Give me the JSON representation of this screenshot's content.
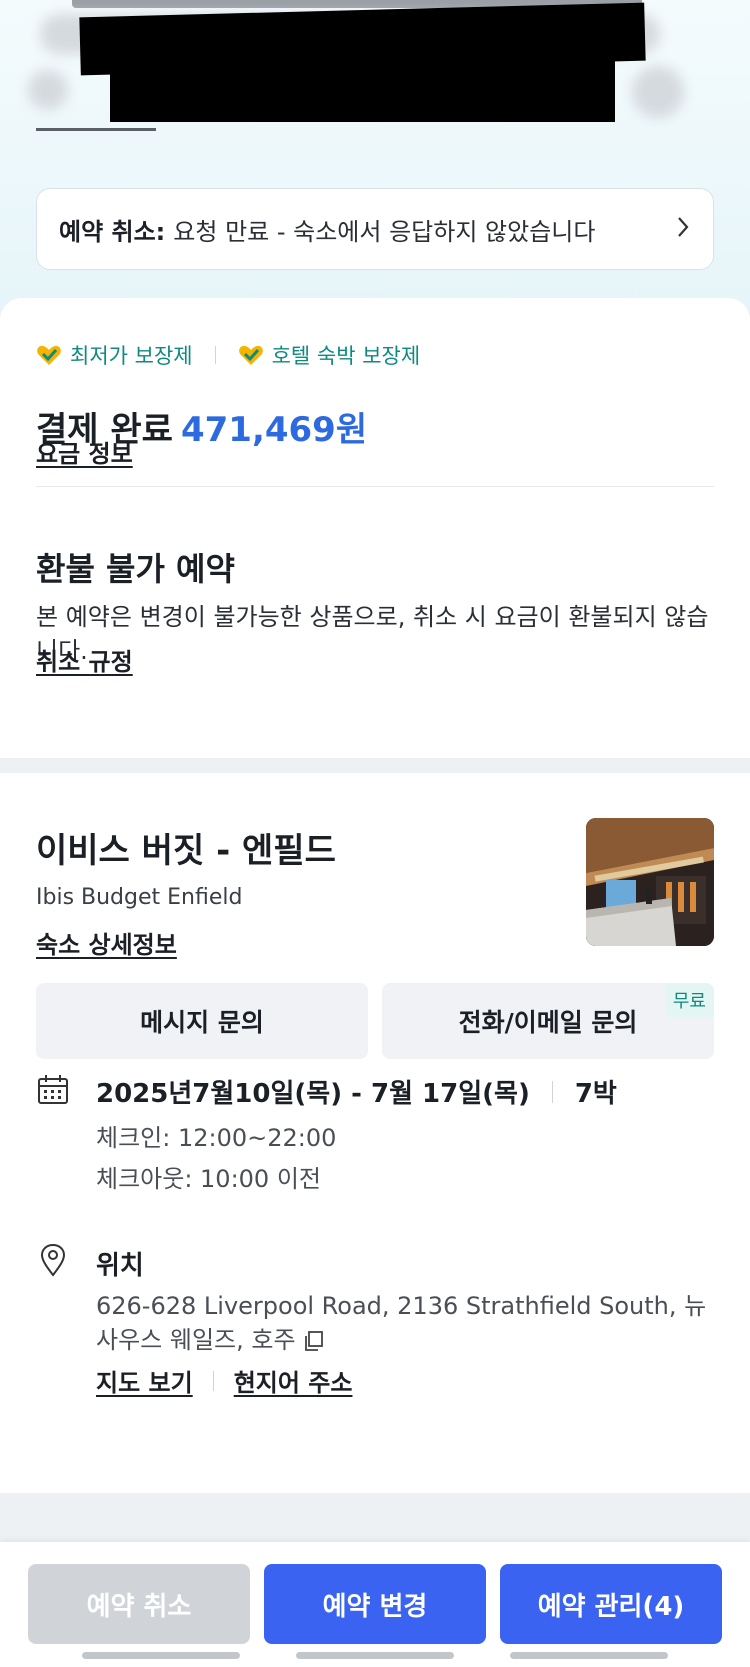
{
  "colors": {
    "accent_blue": "#2d6ae0",
    "teal": "#0e8a80",
    "button_primary": "#3a63f2",
    "button_disabled": "#d0d4d9"
  },
  "cancel_banner": {
    "label": "예약 취소:",
    "text": "요청 만료 - 숙소에서 응답하지 않았습니다",
    "icon": "chevron-right-icon"
  },
  "guarantees": [
    {
      "label": "최저가 보장제",
      "icon": "heart-check-icon"
    },
    {
      "label": "호텔 숙박 보장제",
      "icon": "heart-check-icon"
    }
  ],
  "payment": {
    "label": "결제 완료",
    "amount": "471,469원",
    "link": "요금 정보"
  },
  "refund": {
    "title": "환불 불가 예약",
    "body": "본 예약은 변경이 불가능한 상품으로, 취소 시 요금이 환불되지 않습니다.",
    "link": "취소 규정"
  },
  "hotel": {
    "name_ko": "이비스 버짓 - 엔필드",
    "name_en": "Ibis Budget Enfield",
    "detail_link": "숙소 상세정보"
  },
  "contact": {
    "message": "메시지 문의",
    "phone_email": "전화/이메일 문의",
    "free_tag": "무료"
  },
  "stay": {
    "dates": "2025년7월10일(목) - 7월 17일(목)",
    "nights": "7박",
    "checkin": "체크인: 12:00~22:00",
    "checkout": "체크아웃: 10:00 이전"
  },
  "location": {
    "title": "위치",
    "address": "626-628 Liverpool Road, 2136 Strathfield South, 뉴사우스 웨일즈, 호주",
    "map_link": "지도 보기",
    "local_address_link": "현지어 주소"
  },
  "actions": {
    "cancel": "예약 취소",
    "change": "예약 변경",
    "manage": "예약 관리(4)"
  }
}
